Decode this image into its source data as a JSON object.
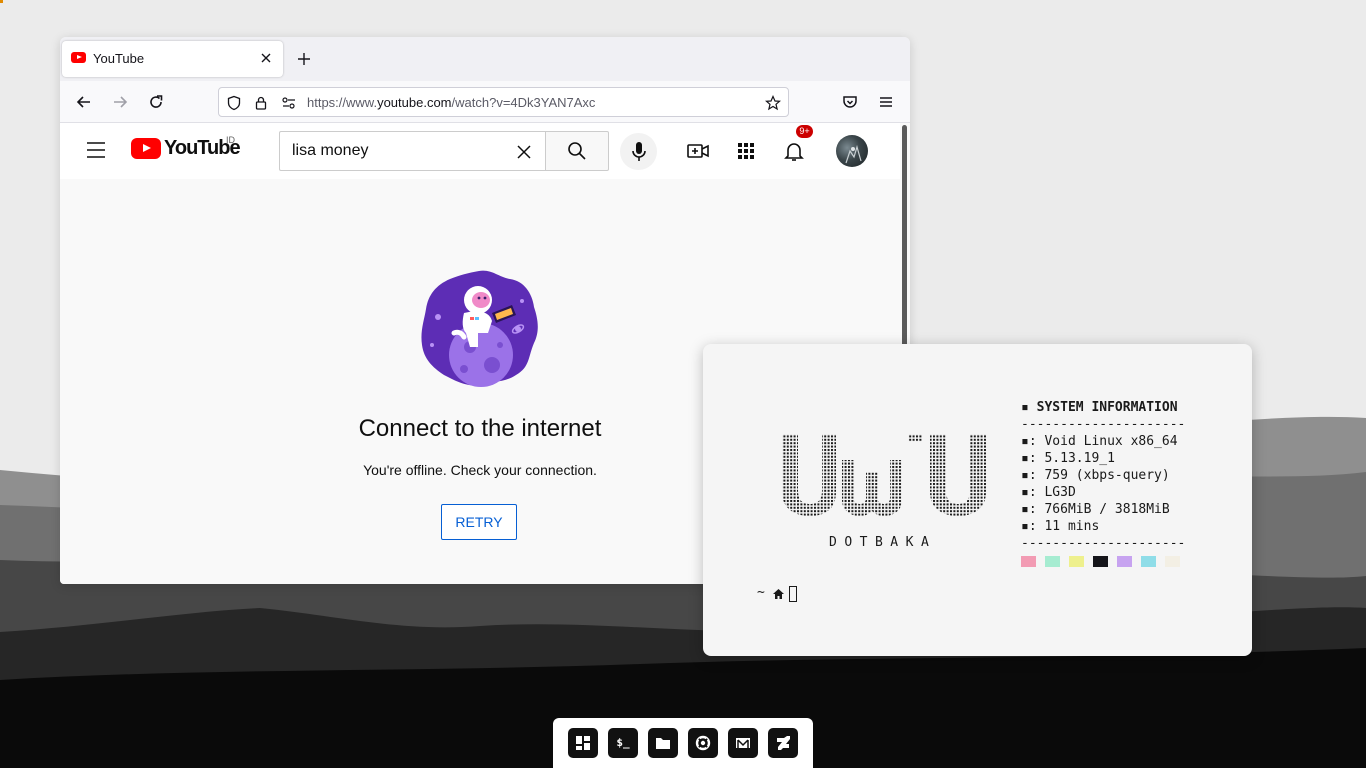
{
  "desktop": {
    "colors": {
      "sky": "#ebebeb",
      "hill_far": "#8f8f8f",
      "hill_mid": "#5e5e5e",
      "hill_near": "#2b2b2b",
      "ground": "#050505"
    }
  },
  "browser": {
    "tab": {
      "title": "YouTube",
      "favicon": "youtube-favicon"
    },
    "url": {
      "prefix": "https://www.",
      "host": "youtube.com",
      "path": "/watch?v=4Dk3YAN7Axc"
    },
    "icons": [
      "back-icon",
      "forward-icon",
      "reload-icon",
      "shield-icon",
      "lock-icon",
      "permissions-icon",
      "bookmark-star-icon",
      "pocket-icon",
      "menu-icon"
    ]
  },
  "youtube": {
    "logo_text": "YouTube",
    "region": "ID",
    "search": {
      "value": "lisa money",
      "placeholder": "Search"
    },
    "notifications_badge": "9+",
    "offline": {
      "title": "Connect to the internet",
      "message": "You're offline. Check your connection.",
      "retry_label": "RETRY"
    },
    "colors": {
      "brand_red": "#ff0000",
      "link_blue": "#065fd4",
      "badge_red": "#cc0000"
    }
  },
  "terminal": {
    "logo_caption": "DOTBAKA",
    "sysinfo": {
      "title": "▪ SYSTEM INFORMATION",
      "divider": "---------------------",
      "lines": [
        "▪: Void Linux x86_64",
        "▪: 5.13.19_1",
        "▪: 759 (xbps-query)",
        "▪: LG3D",
        "▪: 766MiB / 3818MiB",
        "▪: 11 mins"
      ]
    },
    "palette": [
      "#f29bb3",
      "#a6ecd1",
      "#eef08d",
      "#15151a",
      "#c7a3f0",
      "#8fdde8",
      "#f3efe4"
    ],
    "prompt": "~"
  },
  "dock": {
    "items": [
      {
        "name": "dashboard",
        "icon": "dashboard-icon"
      },
      {
        "name": "terminal",
        "label": "$_",
        "icon": "terminal-icon"
      },
      {
        "name": "files",
        "icon": "folder-icon"
      },
      {
        "name": "help",
        "icon": "lifebuoy-icon"
      },
      {
        "name": "mail",
        "icon": "mail-icon"
      },
      {
        "name": "deviantart",
        "icon": "deviantart-icon"
      }
    ]
  }
}
